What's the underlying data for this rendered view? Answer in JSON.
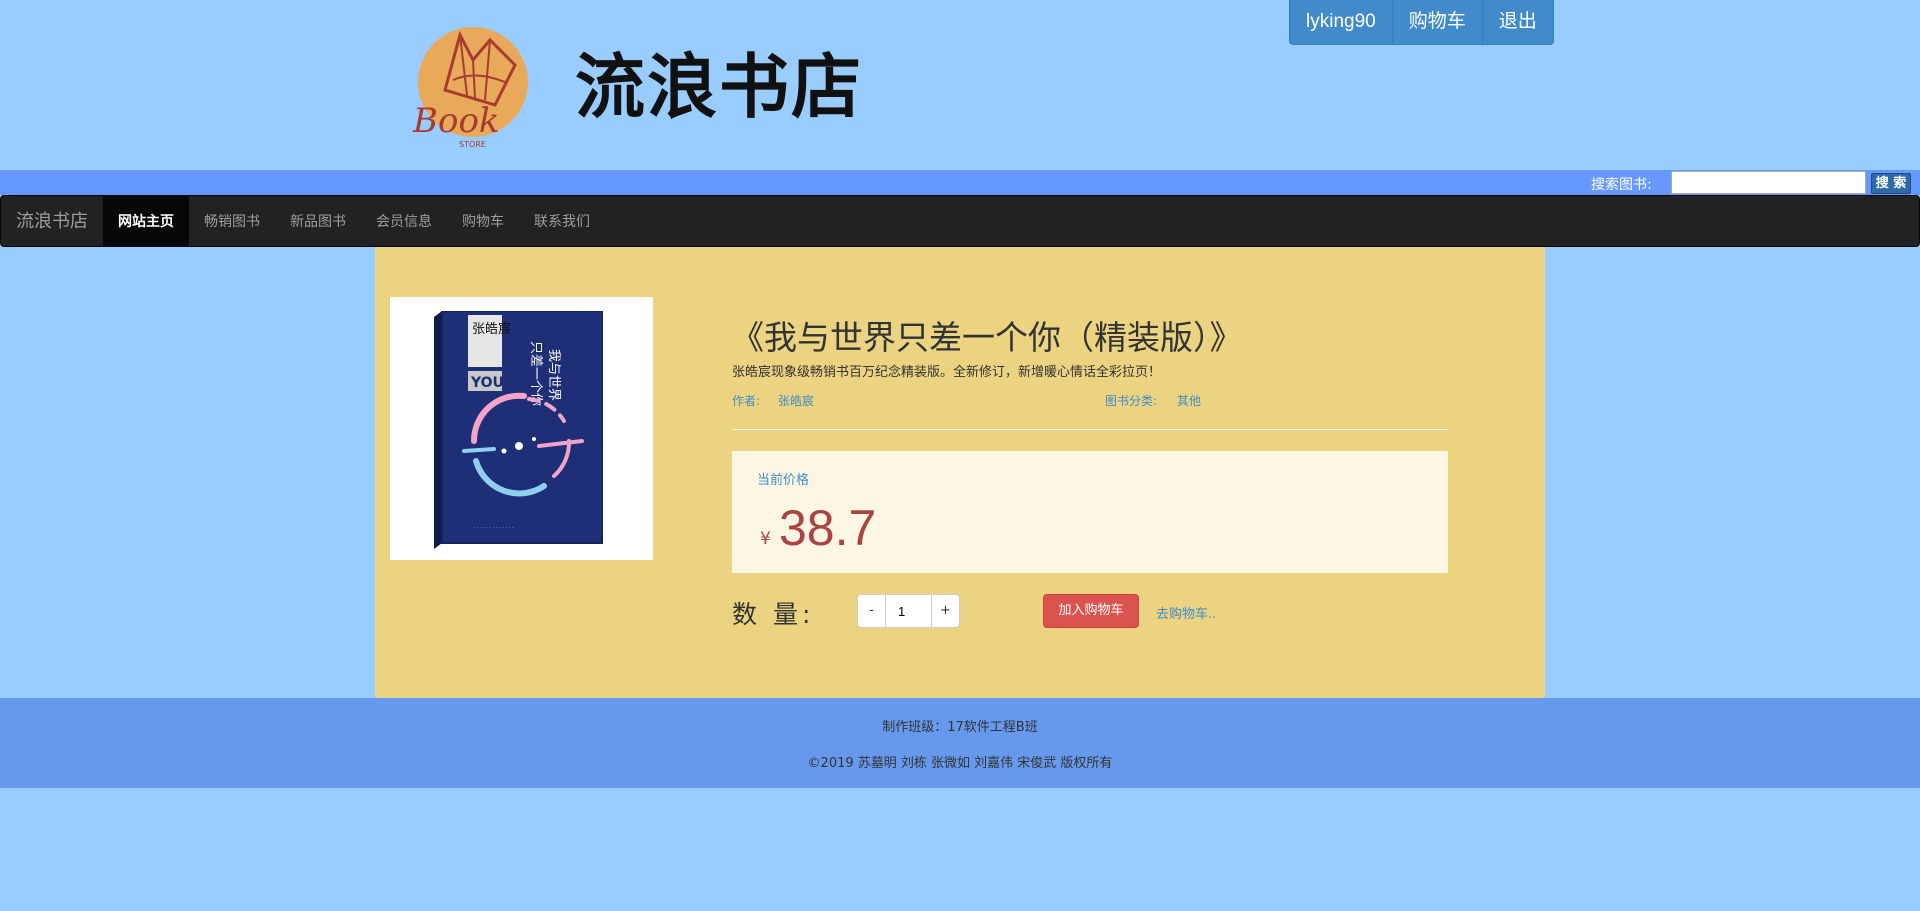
{
  "header": {
    "logo_text": "Book",
    "logo_subtext": "STORE",
    "site_title": "流浪书店",
    "user_nav": {
      "username": "lyking90",
      "cart": "购物车",
      "logout": "退出"
    }
  },
  "search": {
    "label": "搜索图书:",
    "value": "",
    "button": "搜 索"
  },
  "navbar": {
    "brand": "流浪书店",
    "items": [
      {
        "label": "网站主页",
        "active": true
      },
      {
        "label": "畅销图书",
        "active": false
      },
      {
        "label": "新品图书",
        "active": false
      },
      {
        "label": "会员信息",
        "active": false
      },
      {
        "label": "购物车",
        "active": false
      },
      {
        "label": "联系我们",
        "active": false
      }
    ]
  },
  "book": {
    "title": "《我与世界只差一个你（精装版）》",
    "description": "张皓宸现象级畅销书百万纪念精装版。全新修订，新增暖心情话全彩拉页！",
    "author_label": "作者:",
    "author": "张皓宸",
    "category_label": "图书分类:",
    "category": "其他",
    "price_label": "当前价格",
    "currency": "¥",
    "price": "38.7",
    "quantity_label": "数 量:",
    "quantity": "1",
    "minus": "-",
    "plus": "+",
    "add_to_cart": "加入购物车",
    "go_to_cart": "去购物车..",
    "cover_text": {
      "author_short": "张皓宸",
      "title_line1": "我与世界",
      "title_line2": "只差一个你",
      "you": "YOU"
    }
  },
  "footer": {
    "class_info": "制作班级：17软件工程B班",
    "copyright": "©2019 苏墓明 刘栋 张微如 刘嘉伟 宋俊武 版权所有"
  },
  "colors": {
    "page_bg": "#99ccff",
    "search_strip": "#6699ff",
    "navbar_bg": "#222222",
    "main_bg": "#ebd382",
    "price_color": "#a94442",
    "link_blue": "#428bca",
    "danger": "#d9534f",
    "footer_bg": "#6699ee"
  }
}
